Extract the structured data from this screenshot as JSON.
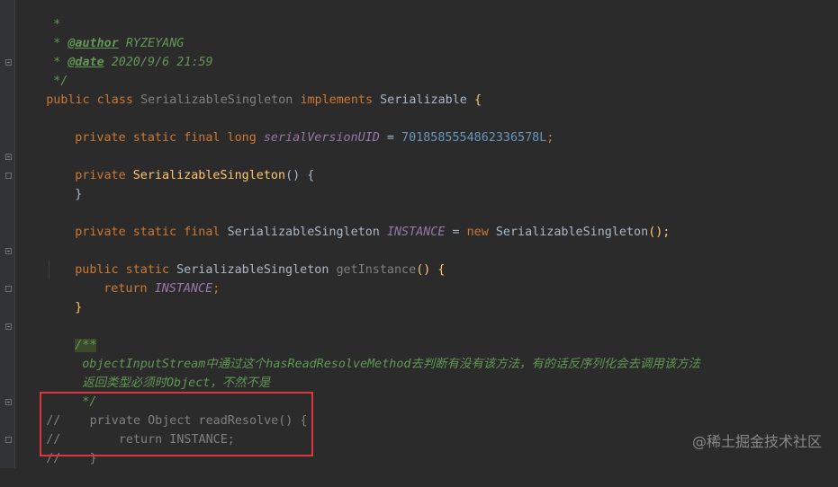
{
  "editor": {
    "lines": {
      "l1": "*",
      "l2_star": "* ",
      "l2_tag": "@author",
      "l2_val": " RYZEYANG",
      "l3_star": "* ",
      "l3_tag": "@date",
      "l3_val": " 2020/9/6 21:59",
      "l4": "*/",
      "l5_kw1": "public class ",
      "l5_cls": "SerializableSingleton ",
      "l5_kw2": "implements ",
      "l5_iface": "Serializable ",
      "l5_brace": "{",
      "l7_kw": "private static final long ",
      "l7_field": "serialVersionUID",
      "l7_eq": " = ",
      "l7_num": "7018585554862336578L",
      "l7_semi": ";",
      "l9_kw": "private ",
      "l9_fn": "SerializableSingleton",
      "l9_rest": "() {",
      "l10": "}",
      "l12_kw": "private static final ",
      "l12_type": "SerializableSingleton ",
      "l12_field": "INSTANCE",
      "l12_eq": " = ",
      "l12_new": "new ",
      "l12_ctor": "SerializableSingleton",
      "l12_end": "();",
      "l14_kw": "public static ",
      "l14_type": "SerializableSingleton ",
      "l14_fn": "getInstance",
      "l14_rest": "() {",
      "l15_kw": "return ",
      "l15_field": "INSTANCE",
      "l15_semi": ";",
      "l16": "}",
      "l18": "/**",
      "l19": "objectInputStream中通过这个hasReadResolveMethod去判断有没有该方法，有的话反序列化会去调用该方法",
      "l20": "返回类型必须时Object，不然不是",
      "l21": "*/",
      "l22_c": "//",
      "l22_code": "    private Object readResolve() {",
      "l23_c": "//",
      "l23_code": "        return INSTANCE;",
      "l24_c": "//",
      "l24_code": "    }"
    }
  },
  "watermark": "@稀土掘金技术社区",
  "colors": {
    "background": "#2b2b2b",
    "keyword": "#cc7832",
    "method": "#ffc66d",
    "field": "#9876aa",
    "number": "#6897bb",
    "doc": "#629755",
    "comment": "#808080",
    "highlight_box": "#d9363e"
  }
}
